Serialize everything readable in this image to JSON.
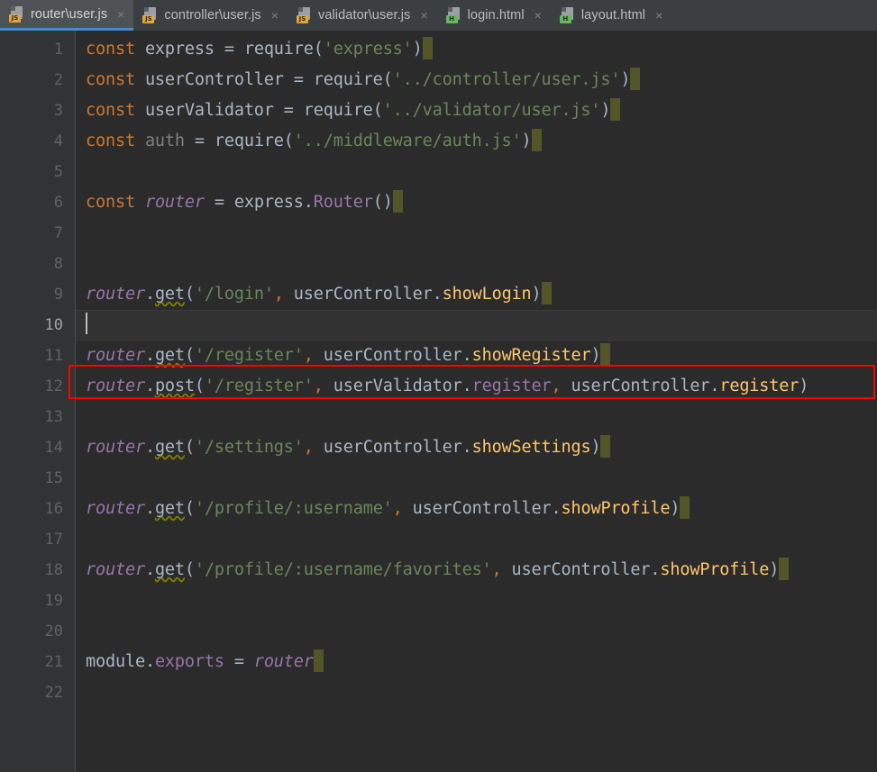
{
  "window": {
    "app": "JetBrains IDE code editor",
    "editor_background": "#2b2b2b",
    "gutter_background": "#313335",
    "tabbar_background": "#3c3f41",
    "active_tab_background": "#4e5254",
    "active_tab_underline": "#4a88c7",
    "annotation_color": "#ff0000"
  },
  "tabs": [
    {
      "label": "router\\user.js",
      "icon": "js-file-icon",
      "badge": "JS",
      "active": true,
      "close": "×"
    },
    {
      "label": "controller\\user.js",
      "icon": "js-file-icon",
      "badge": "JS",
      "active": false,
      "close": "×"
    },
    {
      "label": "validator\\user.js",
      "icon": "js-file-icon",
      "badge": "JS",
      "active": false,
      "close": "×"
    },
    {
      "label": "login.html",
      "icon": "html-file-icon",
      "badge": "H",
      "active": false,
      "close": "×"
    },
    {
      "label": "layout.html",
      "icon": "html-file-icon",
      "badge": "H",
      "active": false,
      "close": "×"
    }
  ],
  "editor": {
    "filename": "router\\user.js",
    "language": "JavaScript",
    "caret_line": 10,
    "caret_column": 1,
    "line_numbers": [
      1,
      2,
      3,
      4,
      5,
      6,
      7,
      8,
      9,
      10,
      11,
      12,
      13,
      14,
      15,
      16,
      17,
      18,
      19,
      20,
      21,
      22
    ],
    "lines": [
      {
        "n": 1,
        "text": "const express = require('express')"
      },
      {
        "n": 2,
        "text": "const userController = require('../controller/user.js')"
      },
      {
        "n": 3,
        "text": "const userValidator = require('../validator/user.js')"
      },
      {
        "n": 4,
        "text": "const auth = require('../middleware/auth.js')"
      },
      {
        "n": 5,
        "text": ""
      },
      {
        "n": 6,
        "text": "const router = express.Router()"
      },
      {
        "n": 7,
        "text": ""
      },
      {
        "n": 8,
        "text": ""
      },
      {
        "n": 9,
        "text": "router.get('/login', userController.showLogin)"
      },
      {
        "n": 10,
        "text": ""
      },
      {
        "n": 11,
        "text": "router.get('/register', userController.showRegister)"
      },
      {
        "n": 12,
        "text": "router.post('/register', userValidator.register, userController.register)"
      },
      {
        "n": 13,
        "text": ""
      },
      {
        "n": 14,
        "text": "router.get('/settings', userController.showSettings)"
      },
      {
        "n": 15,
        "text": ""
      },
      {
        "n": 16,
        "text": "router.get('/profile/:username', userController.showProfile)"
      },
      {
        "n": 17,
        "text": ""
      },
      {
        "n": 18,
        "text": "router.get('/profile/:username/favorites', userController.showProfile)"
      },
      {
        "n": 19,
        "text": ""
      },
      {
        "n": 20,
        "text": ""
      },
      {
        "n": 21,
        "text": "module.exports = router"
      },
      {
        "n": 22,
        "text": ""
      }
    ],
    "highlighted_line": 12,
    "highlighted_line_text": "router.post('/register', userValidator.register, userController.register)"
  }
}
